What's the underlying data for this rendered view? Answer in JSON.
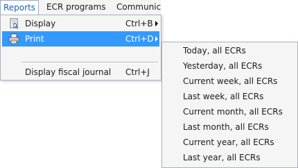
{
  "menubar": {
    "items": [
      {
        "label": "Reports",
        "active": true
      },
      {
        "label": "ECR programs",
        "active": false
      },
      {
        "label": "Communic.",
        "active": false
      }
    ]
  },
  "dropdown": {
    "items": [
      {
        "label": "Display",
        "shortcut": "Ctrl+B",
        "icon": "display-icon",
        "has_submenu": true
      },
      {
        "label": "Print",
        "shortcut": "Ctrl+D",
        "icon": "print-icon",
        "has_submenu": true,
        "selected": true
      },
      {
        "label": "Display fiscal journal",
        "shortcut": "Ctrl+J"
      }
    ]
  },
  "submenu": {
    "items": [
      "Today, all ECRs",
      "Yesterday, all ECRs",
      "Current week, all ECRs",
      "Last week, all ECRs",
      "Current month, all ECRs",
      "Last month, all ECRs",
      "Current year, all ECRs",
      "Last year, all ECRs"
    ]
  },
  "colors": {
    "selection": "#3399ff",
    "active_menu_text": "#1560b8",
    "menu_background": "#f5f5f5"
  }
}
